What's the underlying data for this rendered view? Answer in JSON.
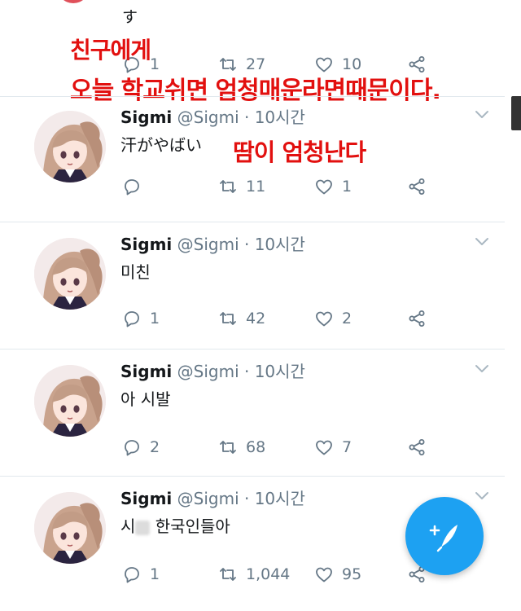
{
  "top_tweet": {
    "text": "す",
    "actions": {
      "replies": "1",
      "retweets": "27",
      "likes": "10"
    }
  },
  "overlay": {
    "line1": "친구에게",
    "line2": "오늘 학교쉬면 엄청매운라면때문이다.",
    "line3": "땀이 엄청난다"
  },
  "tweets": [
    {
      "name": "Sigmi",
      "meta": "@Sigmi · 10시간",
      "text": "汗がやばい",
      "replies": "",
      "retweets": "11",
      "likes": "1"
    },
    {
      "name": "Sigmi",
      "meta": "@Sigmi · 10시간",
      "text": "미친",
      "replies": "1",
      "retweets": "42",
      "likes": "2"
    },
    {
      "name": "Sigmi",
      "meta": "@Sigmi · 10시간",
      "text": "아 시발",
      "replies": "2",
      "retweets": "68",
      "likes": "7"
    },
    {
      "name": "Sigmi",
      "meta": "@Sigmi · 10시간",
      "text_a": "시",
      "text_b": "한국인들아",
      "replies": "1",
      "retweets": "1,044",
      "likes": "95"
    }
  ],
  "icons": {
    "reply": "reply-icon",
    "retweet": "retweet-icon",
    "like": "heart-icon",
    "share": "share-icon",
    "more": "chevron-down-icon",
    "compose": "compose-feather-icon"
  },
  "colors": {
    "accent": "#1da1f2",
    "overlay_text": "#e2100f",
    "muted": "#657786"
  }
}
